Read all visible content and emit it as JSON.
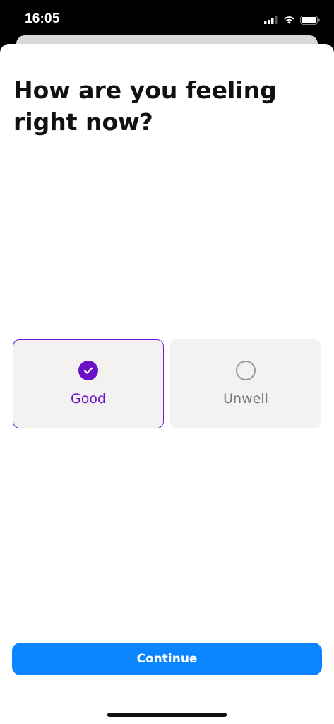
{
  "status_bar": {
    "time": "16:05",
    "icons": [
      "signal-icon",
      "wifi-icon",
      "battery-icon"
    ]
  },
  "page": {
    "title": "How are you feeling right now?"
  },
  "options": [
    {
      "label": "Good",
      "selected": true,
      "icon": "check-circle-icon"
    },
    {
      "label": "Unwell",
      "selected": false,
      "icon": "radio-empty-icon"
    }
  ],
  "continue_button": {
    "label": "Continue"
  },
  "colors": {
    "accent_purple": "#6a10c9",
    "button_blue": "#0a84ff",
    "option_background": "#f3f2f1",
    "unselected_text": "#777777"
  }
}
